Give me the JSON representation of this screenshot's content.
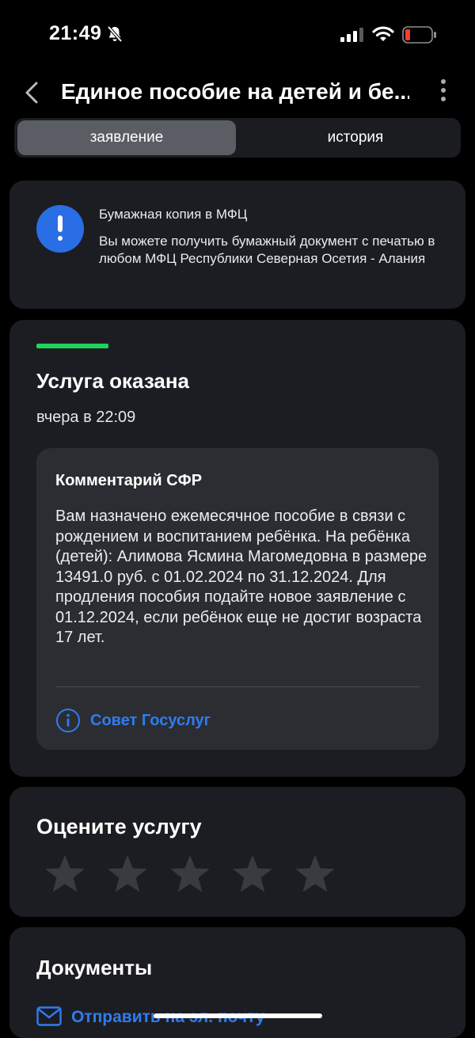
{
  "status_bar": {
    "time": "21:49",
    "icons": [
      "bell-slash-icon",
      "cellular-signal-icon",
      "wifi-icon",
      "battery-low-icon"
    ],
    "battery_color": "#ff3b30"
  },
  "nav": {
    "title": "Единое пособие на детей и бе...",
    "back_icon": "chevron-left-icon",
    "more_icon": "more-vertical-icon"
  },
  "tabs": [
    {
      "label": "заявление",
      "active": true
    },
    {
      "label": "история",
      "active": false
    }
  ],
  "notice": {
    "icon": "exclamation-circle-icon",
    "title": "Бумажная копия в МФЦ",
    "text": "Вы можете получить бумажный документ с печатью в любом МФЦ Республики Северная Осетия - Алания"
  },
  "status": {
    "title": "Услуга оказана",
    "time": "вчера в 22:09",
    "color": "#1fd35a"
  },
  "comment": {
    "title": "Комментарий СФР",
    "text": "Вам назначено ежемесячное пособие в связи с рождением и воспитанием ребёнка. На ребёнка (детей): Алимова Ясмина Магомедовна в размере 13491.0 руб. с 01.02.2024 по 31.12.2024. Для продления пособия подайте новое заявление с 01.12.2024, если ребёнок еще не достиг возраста 17 лет.",
    "tip_label": "Совет Госуслуг",
    "tip_icon": "info-circle-icon"
  },
  "rating": {
    "title": "Оцените услугу",
    "value": 0,
    "max": 5
  },
  "documents": {
    "title": "Документы",
    "email_label": "Отправить на эл. почту",
    "email_icon": "mail-icon"
  },
  "colors": {
    "background": "#000000",
    "card": "#1c1d22",
    "accent_blue": "#2f7cf0",
    "alert_blue": "#2a6ee6",
    "star_inactive": "#3a3b40"
  }
}
